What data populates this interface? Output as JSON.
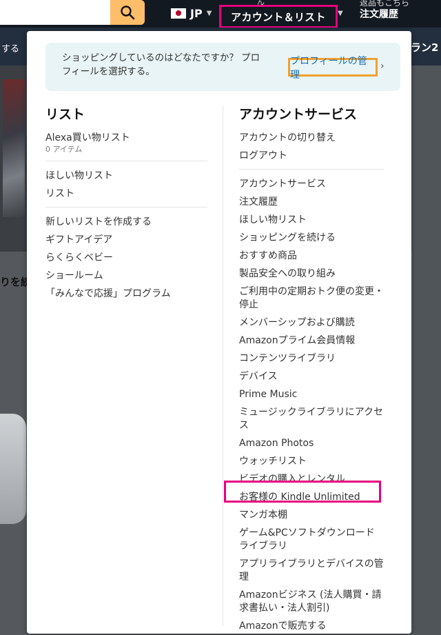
{
  "topbar": {
    "search_placeholder": "",
    "locale_code": "JP",
    "hello_small": "ん",
    "account_label": "アカウント＆リスト",
    "returns_line1": "返品もこちら",
    "returns_line2": "注文履歴"
  },
  "subnav": {
    "left_fragment": "する",
    "right_fragment": "ラン2"
  },
  "background": {
    "fragment_text": "りを続"
  },
  "profile": {
    "prompt": "ショッピングしているのはどなたですか？ プロフィールを選択する。",
    "manage_label": "プロフィールの管理",
    "chevron": "›"
  },
  "lists": {
    "title": "リスト",
    "alexa": "Alexa買い物リスト",
    "alexa_count": "0 アイテム",
    "group2": [
      "ほしい物リスト",
      "リスト"
    ],
    "group3": [
      "新しいリストを作成する",
      "ギフトアイデア",
      "らくらくベビー",
      "ショールーム",
      "「みんなで応援」プログラム"
    ]
  },
  "account_services": {
    "title": "アカウントサービス",
    "group1": [
      "アカウントの切り替え",
      "ログアウト"
    ],
    "group2": [
      "アカウントサービス",
      "注文履歴",
      "ほしい物リスト",
      "ショッピングを続ける",
      "おすすめ商品",
      "製品安全への取り組み",
      "ご利用中の定期おトク便の変更・停止",
      "メンバーシップおよび購読",
      "Amazonプライム会員情報",
      "コンテンツライブラリ",
      "デバイス",
      "Prime Music",
      "ミュージックライブラリにアクセス",
      "Amazon Photos",
      "ウォッチリスト",
      "ビデオの購入とレンタル",
      "お客様の Kindle Unlimited",
      "マンガ本棚",
      "ゲーム&PCソフトダウンロードライブラリ",
      "アプリライブラリとデバイスの管理",
      "Amazonビジネス (法人購買・請求書払い・法人割引)",
      "Amazonで販売する"
    ]
  },
  "colors": {
    "nav_dark": "#131921",
    "search_button": "#febd69",
    "highlight_pink": "#e6007e",
    "highlight_orange": "#f0a030",
    "link_blue": "#1a73b5",
    "profile_bg": "#e8f4f6"
  },
  "icons": {
    "search": "search-icon",
    "flag": "japan-flag-icon",
    "chevron": "chevron-right-icon"
  }
}
